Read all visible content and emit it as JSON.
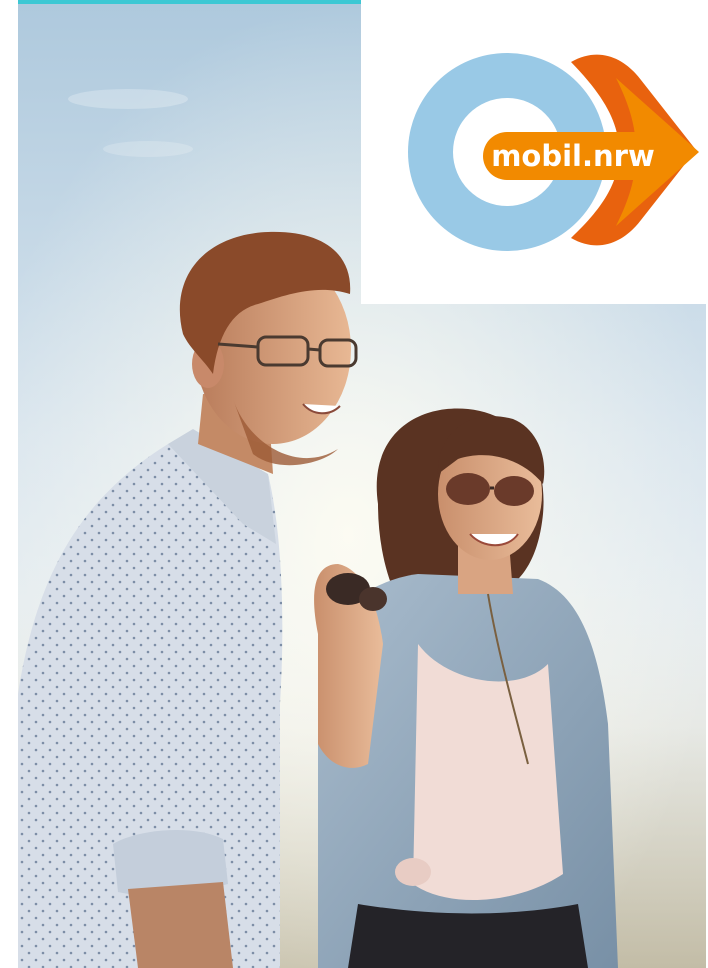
{
  "logo": {
    "wordmark": "mobil.nrw",
    "icon": "mobil-nrw-logo-icon"
  },
  "photo": {
    "icon": "lifestyle-photo-couple-smiling"
  },
  "colors": {
    "accent_line": "#3cc8d4",
    "logo_ring_blue": "#99c9e6",
    "logo_orange_dark": "#e8620e",
    "logo_orange_light": "#f28a00",
    "logo_text": "#ffffff",
    "sky_top": "#b6cfe2",
    "sky_bottom": "#eef3f7"
  }
}
